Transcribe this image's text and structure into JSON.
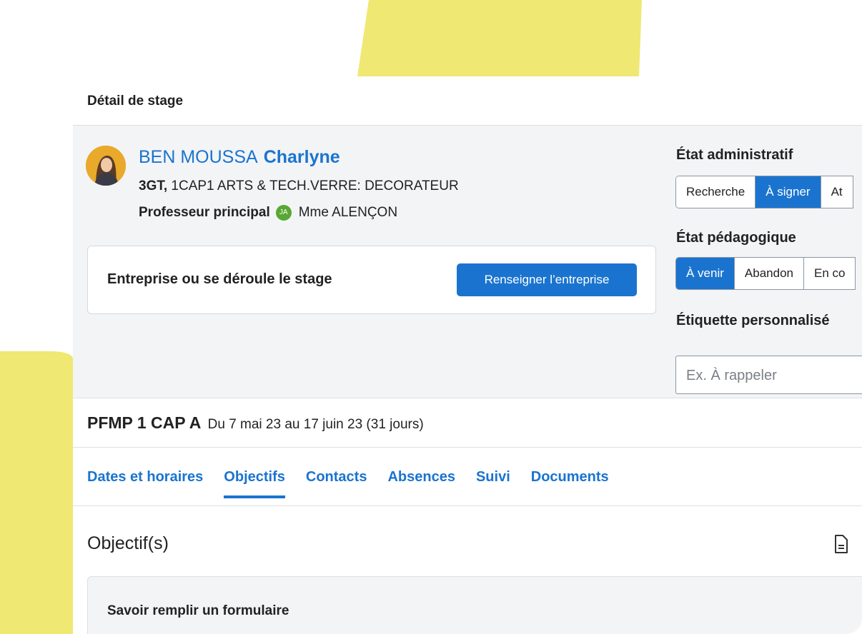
{
  "page": {
    "title": "Détail de stage"
  },
  "student": {
    "last_name": "BEN MOUSSA",
    "first_name": "Charlyne",
    "class_code": "3GT,",
    "class_name": "1CAP1 ARTS & TECH.VERRE: DECORATEUR",
    "prof_label": "Professeur principal",
    "prof_initials": "JA",
    "prof_name": "Mme ALENÇON"
  },
  "company": {
    "label": "Entreprise ou se déroule le stage",
    "button": "Renseigner l’entreprise"
  },
  "admin_state": {
    "label": "État administratif",
    "options": [
      "Recherche",
      "À signer",
      "At"
    ],
    "selected": "À signer"
  },
  "peda_state": {
    "label": "État pédagogique",
    "options": [
      "À venir",
      "Abandon",
      "En co"
    ],
    "selected": "À venir"
  },
  "custom_tag": {
    "label": "Étiquette personnalisé",
    "placeholder": "Ex. À rappeler"
  },
  "period": {
    "code": "PFMP 1 CAP A",
    "dates": "Du 7 mai 23 au 17 juin 23 (31 jours)"
  },
  "tabs": [
    "Dates et horaires",
    "Objectifs",
    "Contacts",
    "Absences",
    "Suivi",
    "Documents"
  ],
  "active_tab": "Objectifs",
  "objectives": {
    "title": "Objectif(s)",
    "items": [
      "Savoir remplir un formulaire"
    ]
  },
  "colors": {
    "accent": "#1a74cf",
    "highlight": "#efe872",
    "prof_badge": "#58a832"
  }
}
